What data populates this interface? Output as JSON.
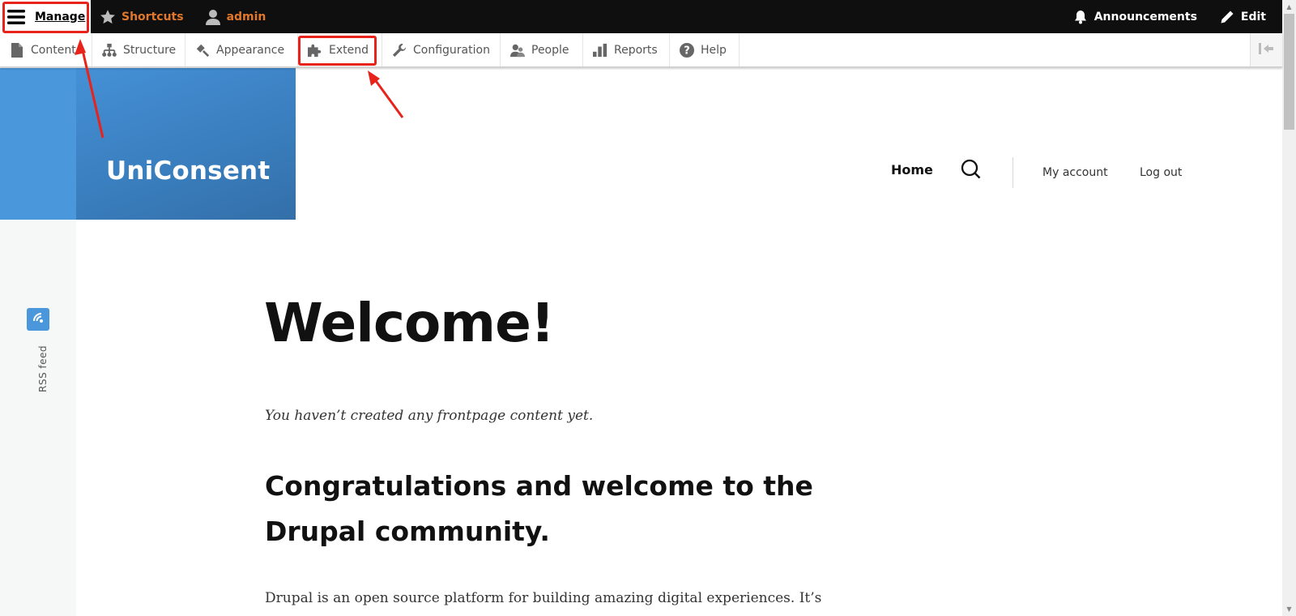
{
  "toolbar": {
    "manage_label": "Manage",
    "shortcuts_label": "Shortcuts",
    "user_label": "admin",
    "announcements_label": "Announcements",
    "edit_label": "Edit"
  },
  "tray": {
    "items": [
      {
        "label": "Content",
        "icon": "file-icon"
      },
      {
        "label": "Structure",
        "icon": "sitemap-icon"
      },
      {
        "label": "Appearance",
        "icon": "paintbrush-icon"
      },
      {
        "label": "Extend",
        "icon": "puzzle-icon"
      },
      {
        "label": "Configuration",
        "icon": "wrench-icon"
      },
      {
        "label": "People",
        "icon": "people-icon"
      },
      {
        "label": "Reports",
        "icon": "bar-chart-icon"
      },
      {
        "label": "Help",
        "icon": "help-icon"
      }
    ],
    "collapse_icon": "collapse-orientation-icon"
  },
  "site": {
    "name": "UniConsent"
  },
  "main_nav": {
    "home": "Home",
    "search_icon": "search-icon",
    "my_account": "My account",
    "log_out": "Log out"
  },
  "sidebar": {
    "rss_label": "RSS feed"
  },
  "content": {
    "title": "Welcome!",
    "empty_message": "You haven’t created any frontpage content yet.",
    "subtitle": "Congratulations and welcome to the Drupal community.",
    "paragraph": "Drupal is an open source platform for building amazing digital experiences. It’s"
  },
  "colors": {
    "toolbar_bg": "#0f0f0f",
    "toolbar_accent": "#e0772a",
    "brand_blue": "#3a7fbf",
    "annotation_red": "#e8231b"
  }
}
